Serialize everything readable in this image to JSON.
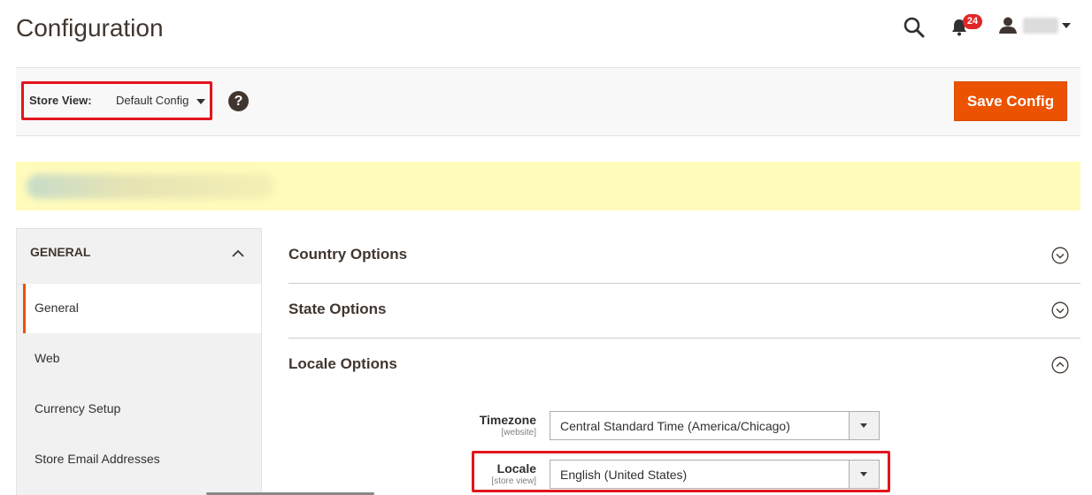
{
  "header": {
    "title": "Configuration",
    "notifications_count": "24",
    "icons": [
      "search-icon",
      "bell-icon",
      "user-icon",
      "caret-down-icon"
    ]
  },
  "toolbar": {
    "store_view_label": "Store View:",
    "store_view_value": "Default Config",
    "help_symbol": "?",
    "save_label": "Save Config"
  },
  "sidebar": {
    "group_label": "GENERAL",
    "items": [
      {
        "label": "General",
        "active": true
      },
      {
        "label": "Web",
        "active": false
      },
      {
        "label": "Currency Setup",
        "active": false
      },
      {
        "label": "Store Email Addresses",
        "active": false
      }
    ]
  },
  "sections": [
    {
      "title": "Country Options",
      "expanded": false
    },
    {
      "title": "State Options",
      "expanded": false
    },
    {
      "title": "Locale Options",
      "expanded": true
    }
  ],
  "locale_fields": [
    {
      "label": "Timezone",
      "scope": "[website]",
      "value": "Central Standard Time (America/Chicago)"
    },
    {
      "label": "Locale",
      "scope": "[store view]",
      "value": "English (United States)"
    }
  ],
  "colors": {
    "accent": "#eb5202",
    "highlight_border": "#e2141c",
    "notice_bg": "#fffbbb",
    "badge": "#e22626"
  }
}
